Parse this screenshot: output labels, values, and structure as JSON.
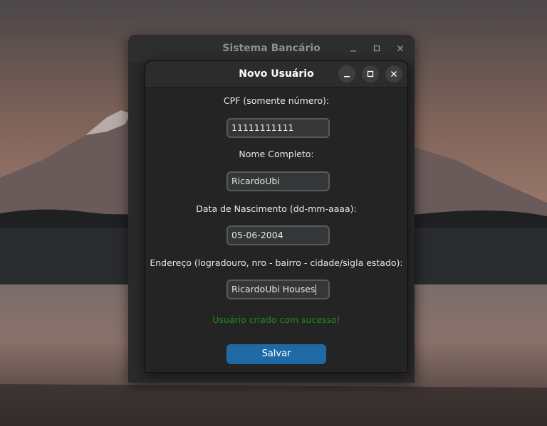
{
  "main_window": {
    "title": "Sistema Bancário",
    "controls": [
      "minimize-icon",
      "maximize-icon",
      "close-icon"
    ]
  },
  "dialog": {
    "title": "Novo Usuário",
    "controls": [
      "minimize-icon",
      "maximize-icon",
      "close-icon"
    ],
    "fields": [
      {
        "label": "CPF (somente número):",
        "value": "11111111111"
      },
      {
        "label": "Nome Completo:",
        "value": "RicardoUbi"
      },
      {
        "label": "Data de Nascimento (dd-mm-aaaa):",
        "value": "05-06-2004"
      },
      {
        "label": "Endereço (logradouro, nro - bairro - cidade/sigla estado):",
        "value": "RicardoUbi Houses"
      }
    ],
    "status_message": "Usuário criado com sucesso!",
    "save_label": "Salvar"
  },
  "colors": {
    "accent_button": "#1f6aa5",
    "success_text": "#1e8a1e",
    "dialog_background": "#242424"
  }
}
